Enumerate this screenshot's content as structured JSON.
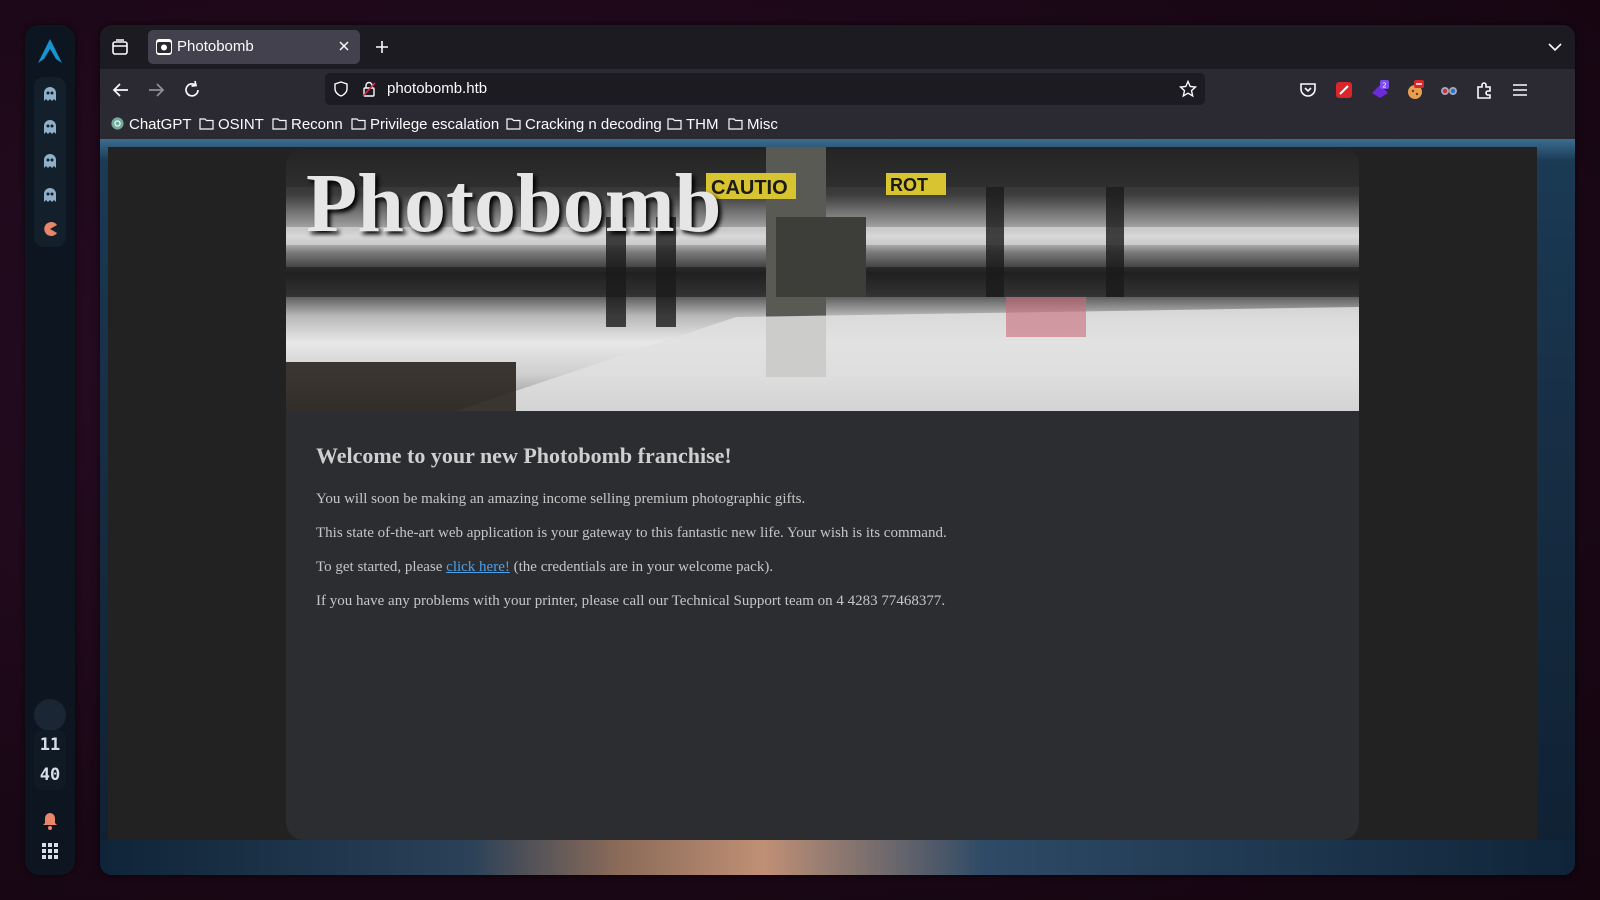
{
  "dock": {
    "clock_hour": "11",
    "clock_minute": "40",
    "workspaces": [
      "ghost-icon",
      "ghost-icon",
      "ghost-icon",
      "ghost-icon",
      "pacman-icon"
    ]
  },
  "browser": {
    "tab": {
      "title": "Photobomb"
    },
    "url": "photobomb.htb",
    "bookmarks": [
      "ChatGPT",
      "OSINT",
      "Reconn",
      "Privilege escalation",
      "Cracking n decoding",
      "THM",
      "Misc"
    ]
  },
  "site": {
    "title": "Photobomb",
    "heading": "Welcome to your new Photobomb franchise!",
    "p1": "You will soon be making an amazing income selling premium photographic gifts.",
    "p2": "This state of-the-art web application is your gateway to this fantastic new life. Your wish is its command.",
    "p3_before": "To get started, please ",
    "p3_link": "click here!",
    "p3_after": " (the credentials are in your welcome pack).",
    "p4": "If you have any problems with your printer, please call our Technical Support team on 4 4283 77468377.",
    "banner_labels": [
      "CAUTIO",
      "ROT"
    ]
  },
  "colors": {
    "accent_link": "#4ea0e8",
    "dock_bg": "#0c1520",
    "browser_bg": "#1c1b22",
    "card_bg": "#2b2d30"
  }
}
